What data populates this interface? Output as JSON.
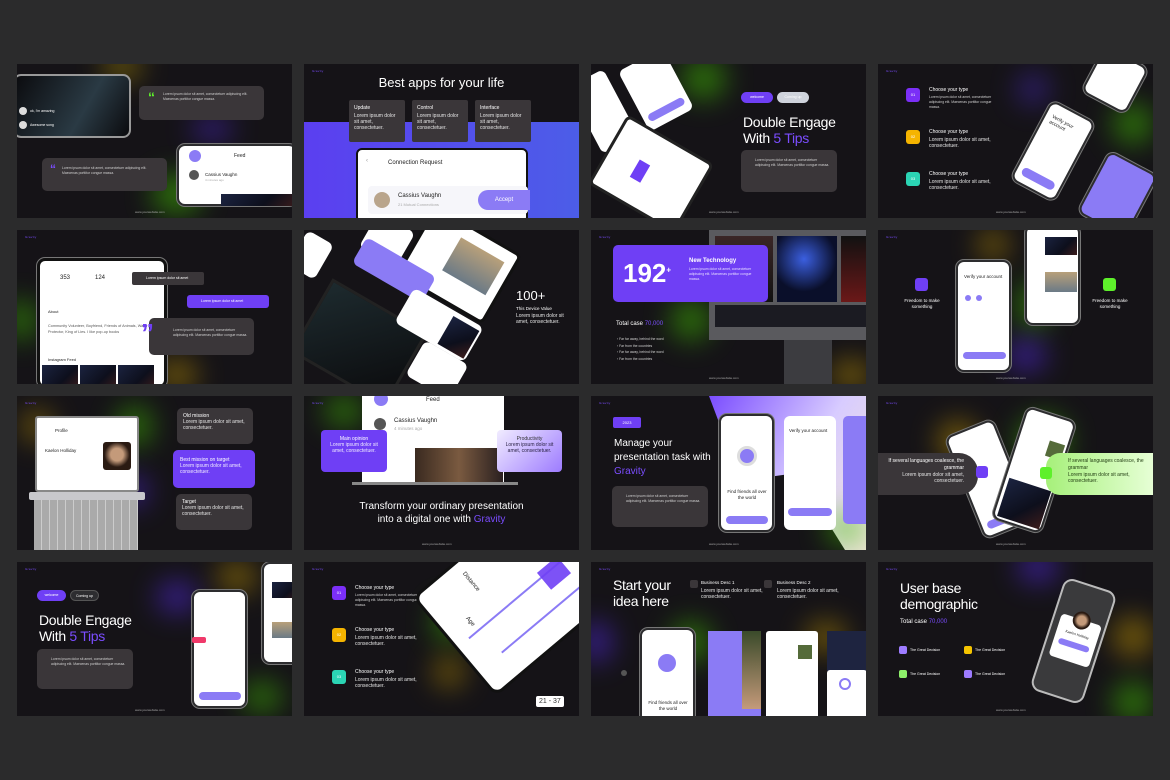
{
  "brand": "Gravity",
  "footer_url": "www.yourwebsite.com",
  "colors": {
    "background": "#2b2b2c",
    "slide": "#151317",
    "accent": "#6f3ff5",
    "yellow": "#f5b400",
    "teal": "#2bd4b4",
    "green": "#5ef02b"
  },
  "lorem": "Lorem ipsum dolor sit amet, consectetuer adipiscing elit. Maecenas porttitor congue massa.",
  "lorem_short": "Lorem ipsum dolor sit amet, consectetuer.",
  "slides": [
    {
      "chat1": "ok, I'm amazing",
      "chat2": "Awesome song",
      "feed": "Feed",
      "user": "Cassius Vaughn",
      "time": "4 minutes ago"
    },
    {
      "title": "Best apps for your life",
      "cards": [
        "Update",
        "Control",
        "Interface"
      ],
      "panel_title": "Connection Request",
      "user": "Cassius Vaughn",
      "mutual": "21 Mutual Connections",
      "accept": "Accept"
    },
    {
      "chip1": "welcome",
      "chip2": "Coming up",
      "title1": "Double Engage",
      "title2a": "With ",
      "title2b": "5 Tips"
    },
    {
      "items": [
        {
          "n": "01",
          "t": "Choose your type"
        },
        {
          "n": "02",
          "t": "Choose your type"
        },
        {
          "n": "03",
          "t": "Choose your type"
        }
      ],
      "phone_title": "Verify your account"
    },
    {
      "stat1": "353",
      "stat2": "124",
      "about": "About",
      "bio": "Community Volunteer, Boyfriend, Friends of Animals, Water Protector, King of Lies. I like pop-up books",
      "feed": "Instagram Feed",
      "tip": "Lorem ipsum dolor sit amet"
    },
    {
      "big": "100+",
      "sub": "This Device Value"
    },
    {
      "big": "192",
      "sup": "+",
      "head": "New Technology",
      "total": "Total case ",
      "total_val": "70,000",
      "bullets": [
        "Far far away, behind the word",
        "Far from the countries",
        "Far far away, behind the word",
        "Far from the countries"
      ]
    },
    {
      "left": "Freedom to make something",
      "right": "Freedom to make something",
      "phone_title": "Verify your account"
    },
    {
      "profile": "Profile",
      "name": "Kaelon Holliday",
      "cards": [
        "Old mission",
        "Best mission on target",
        "Target"
      ]
    },
    {
      "feed": "Feed",
      "user": "Cassius Vaughn",
      "time": "4 minutes ago",
      "left": "Main opinion",
      "right": "Productivity",
      "title1": "Transform your ordinary presentation",
      "title2a": "into a digital one with ",
      "title2b": "Gravity"
    },
    {
      "badge": "2023",
      "title1": "Manage your",
      "title2": "presentation task with",
      "title3": "Gravity",
      "find": "Find friends all over the world",
      "verify": "Verify your account"
    },
    {
      "left": "If several languages coalesce, the grammar",
      "right": "If several languages coalesce, the grammar"
    },
    {
      "chip1": "welcome",
      "chip2": "Coming up",
      "title1": "Double Engage",
      "title2a": "With ",
      "title2b": "5 Tips"
    },
    {
      "items": [
        {
          "n": "01",
          "t": "Choose your type"
        },
        {
          "n": "02",
          "t": "Choose your type"
        },
        {
          "n": "03",
          "t": "Choose your type"
        }
      ],
      "distance": "Distance",
      "age": "Age",
      "range": "21 - 37"
    },
    {
      "title1": "Start your",
      "title2": "idea here",
      "d1": "Business Desc 1",
      "d2": "Business Desc 2",
      "find": "Find friends all over the world"
    },
    {
      "title1": "User base",
      "title2": "demographic",
      "total": "Total case ",
      "total_val": "70,000",
      "items": [
        "The Great Decision",
        "The Great Decision",
        "The Great Decision",
        "The Great Decision"
      ],
      "name": "Kaelon Holliday"
    }
  ]
}
